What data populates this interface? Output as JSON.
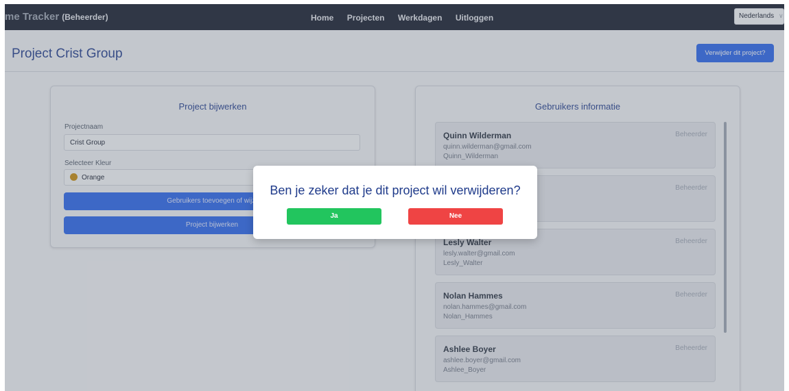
{
  "navbar": {
    "brand": "me Tracker",
    "role": "(Beheerder)",
    "links": [
      "Home",
      "Projecten",
      "Werkdagen",
      "Uitloggen"
    ],
    "language": "Nederlands"
  },
  "header": {
    "title": "Project Crist Group",
    "delete_label": "Verwijder dit project?"
  },
  "edit_card": {
    "title": "Project bijwerken",
    "name_label": "Projectnaam",
    "name_value": "Crist Group",
    "color_label": "Selecteer Kleur",
    "color_value": "Orange",
    "color_hex": "#ca8a04",
    "manage_users_label": "Gebruikers toevoegen of wijzi",
    "update_label": "Project bijwerken"
  },
  "users_card": {
    "title": "Gebruikers informatie",
    "users": [
      {
        "name": "Quinn Wilderman",
        "email": "quinn.wilderman@gmail.com",
        "username": "Quinn_Wilderman",
        "role": "Beheerder"
      },
      {
        "name": "",
        "email": "",
        "username": "",
        "role": "Beheerder"
      },
      {
        "name": "Lesly Walter",
        "email": "lesly.walter@gmail.com",
        "username": "Lesly_Walter",
        "role": "Beheerder"
      },
      {
        "name": "Nolan Hammes",
        "email": "nolan.hammes@gmail.com",
        "username": "Nolan_Hammes",
        "role": "Beheerder"
      },
      {
        "name": "Ashlee Boyer",
        "email": "ashlee.boyer@gmail.com",
        "username": "Ashlee_Boyer",
        "role": "Beheerder"
      }
    ]
  },
  "modal": {
    "question": "Ben je zeker dat je dit project wil verwijderen?",
    "yes_label": "Ja",
    "no_label": "Nee"
  },
  "colors": {
    "navbar": "#111827",
    "primary": "#2563eb",
    "confirm": "#22c55e",
    "cancel": "#ef4444"
  }
}
